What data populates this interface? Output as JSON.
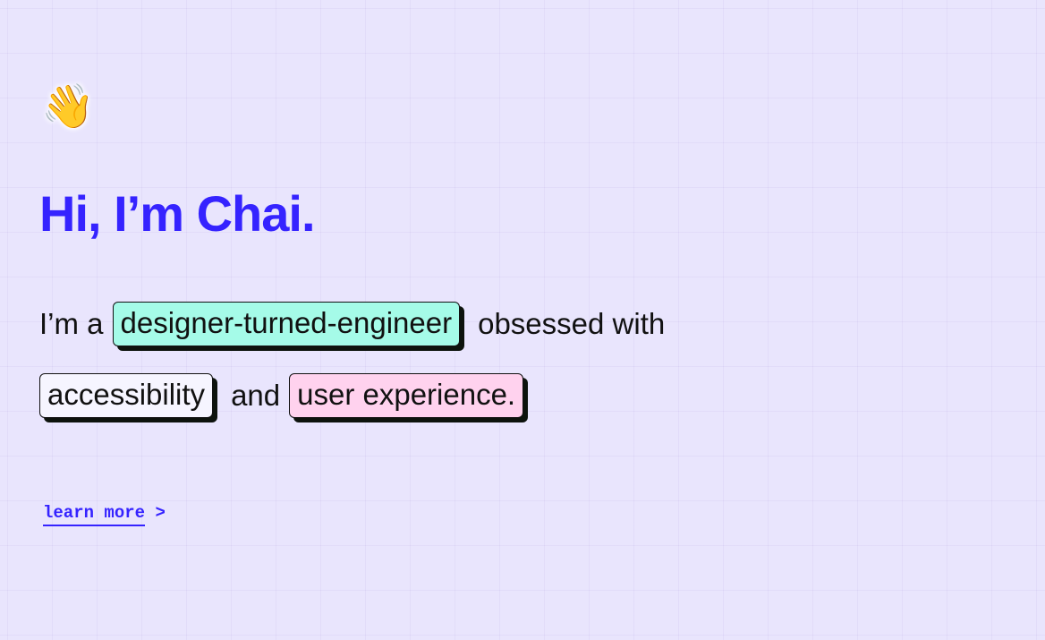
{
  "hero": {
    "wave_emoji": "👋",
    "title": "Hi, I’m Chai.",
    "intro_prefix": "I’m a",
    "tag_role": "designer-turned-engineer",
    "intro_mid": "obsessed with",
    "tag_accessibility": "accessibility",
    "conjunction": "and",
    "tag_ux": "user experience.",
    "learn_more": "learn more",
    "learn_more_arrow": ">"
  },
  "colors": {
    "accent": "#3523ff",
    "background": "#e9e5fd",
    "tag_cyan": "#a5fbe8",
    "tag_white": "#f6f5ff",
    "tag_pink": "#ffd2ee"
  }
}
